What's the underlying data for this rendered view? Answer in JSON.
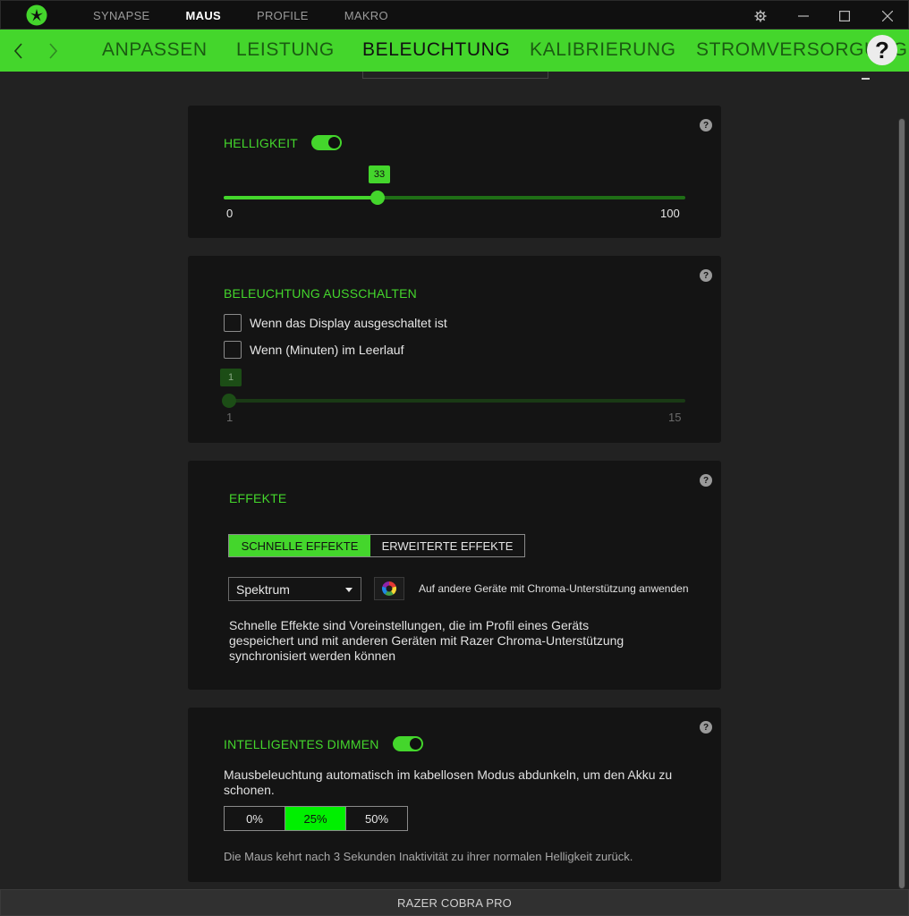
{
  "topnav": {
    "items": [
      "SYNAPSE",
      "MAUS",
      "PROFILE",
      "MAKRO"
    ],
    "active": "MAUS"
  },
  "window": {
    "settings_icon": "gear-icon",
    "minimize_icon": "minimize-icon",
    "maximize_icon": "maximize-icon",
    "close_icon": "close-icon"
  },
  "subnav": {
    "tabs": [
      "ANPASSEN",
      "LEISTUNG",
      "BELEUCHTUNG",
      "KALIBRIERUNG",
      "STROMVERSORGUNG"
    ],
    "active": "BELEUCHTUNG",
    "help_label": "?"
  },
  "colors": {
    "accent": "#44d62c",
    "selected_percent": "#00f000",
    "background": "#222222",
    "card": "#141414"
  },
  "brightness": {
    "title": "HELLIGKEIT",
    "enabled": true,
    "value": 33,
    "value_label": "33",
    "min_label": "0",
    "max_label": "100",
    "min": 0,
    "max": 100,
    "help": "?"
  },
  "lights_off": {
    "title": "BELEUCHTUNG AUSSCHALTEN",
    "option_display": "Wenn das Display ausgeschaltet ist",
    "option_display_checked": false,
    "option_idle": "Wenn (Minuten) im Leerlauf",
    "option_idle_checked": false,
    "idle_value": 1,
    "idle_value_label": "1",
    "min_label": "1",
    "max_label": "15",
    "min": 1,
    "max": 15,
    "help": "?"
  },
  "effects": {
    "title": "EFFEKTE",
    "tab_quick": "SCHNELLE EFFEKTE",
    "tab_advanced": "ERWEITERTE EFFEKTE",
    "active_tab": "SCHNELLE EFFEKTE",
    "effect_selected": "Spektrum",
    "chroma_apply_label": "Auf andere Geräte mit Chroma-Unterstützung anwenden",
    "description_line1": "Schnelle Effekte sind Voreinstellungen, die im Profil eines Geräts",
    "description_line2": "gespeichert und mit anderen Geräten mit Razer Chroma-Unterstützung",
    "description_line3": "synchronisiert werden können",
    "help": "?"
  },
  "smart_dimming": {
    "title": "INTELLIGENTES DIMMEN",
    "enabled": true,
    "description_line1": "Mausbeleuchtung automatisch im kabellosen Modus abdunkeln, um den Akku zu",
    "description_line2": "schonen.",
    "options": [
      "0%",
      "25%",
      "50%"
    ],
    "selected": "25%",
    "note": "Die Maus kehrt nach 3 Sekunden Inaktivität zu ihrer normalen Helligkeit zurück.",
    "help": "?"
  },
  "footer": {
    "device_name": "RAZER COBRA PRO"
  }
}
